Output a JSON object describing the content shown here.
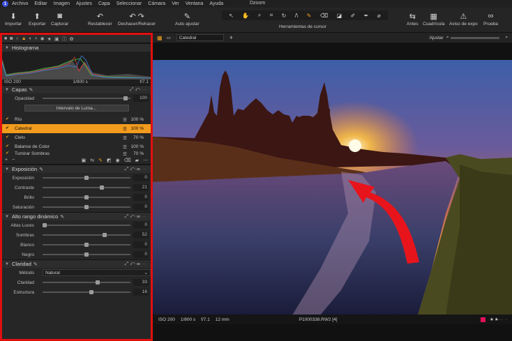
{
  "menu": {
    "items": [
      "Archivo",
      "Editar",
      "Imagen",
      "Ajustes",
      "Capa",
      "Seleccionar",
      "Cámara",
      "Ver",
      "Ventana",
      "Ayuda"
    ],
    "app_title": "Dzoom"
  },
  "toolbar": {
    "importar": "Importar",
    "exportar": "Exportar",
    "capturar": "Capturar",
    "restablecer": "Restablecer",
    "deshacer": "Deshacer/Rehacer",
    "auto": "Auto ajustar",
    "cursor_tools": "Herramientas de cursor",
    "antes": "Antes",
    "cuadricula": "Cuadrícula",
    "aviso": "Aviso de expo",
    "prueba": "Prueba"
  },
  "histogram": {
    "title": "Histograma",
    "iso": "ISO 200",
    "shutter": "1/800 s",
    "aperture": "f/7.1"
  },
  "layers": {
    "title": "Capas",
    "opacity_label": "Opacidad",
    "opacity_value": "100",
    "luma_button": "Intervalo de Luma...",
    "items": [
      {
        "name": "Río",
        "value": "100 %"
      },
      {
        "name": "Catedral",
        "value": "100 %"
      },
      {
        "name": "Cielo",
        "value": "70 %"
      },
      {
        "name": "Balance de Color",
        "value": "100 %"
      },
      {
        "name": "Tumirar Sombras",
        "value": "70 %"
      }
    ]
  },
  "exposure": {
    "title": "Exposición",
    "sliders": [
      {
        "label": "Exposición",
        "value": "0",
        "pos": 0.5
      },
      {
        "label": "Contraste",
        "value": "21",
        "pos": 0.68
      },
      {
        "label": "Brillo",
        "value": "0",
        "pos": 0.5
      },
      {
        "label": "Saturación",
        "value": "0",
        "pos": 0.5
      }
    ]
  },
  "hdr": {
    "title": "Alto rango dinámico",
    "sliders": [
      {
        "label": "Altas Luces",
        "value": "0",
        "pos": 0.0
      },
      {
        "label": "Sombras",
        "value": "52",
        "pos": 0.72
      },
      {
        "label": "Blanco",
        "value": "0",
        "pos": 0.5
      },
      {
        "label": "Negro",
        "value": "0",
        "pos": 0.5
      }
    ]
  },
  "clarity": {
    "title": "Claridad",
    "method_label": "Método",
    "method_value": "Natural",
    "sliders": [
      {
        "label": "Claridad",
        "value": "33",
        "pos": 0.63
      },
      {
        "label": "Estructura",
        "value": "16",
        "pos": 0.56
      }
    ]
  },
  "viewer": {
    "variant": "Catedral",
    "fit": "Ajustar"
  },
  "status": {
    "iso": "ISO 200",
    "shutter": "1/800 s",
    "aperture": "f/7.1",
    "focal": "12 mm",
    "filename": "P1000338.RW2 [4]",
    "stars": "★★·· ·"
  },
  "colors": {
    "accent": "#f29b1d",
    "highlight_border": "#e01010",
    "arrow": "#e8141c"
  }
}
